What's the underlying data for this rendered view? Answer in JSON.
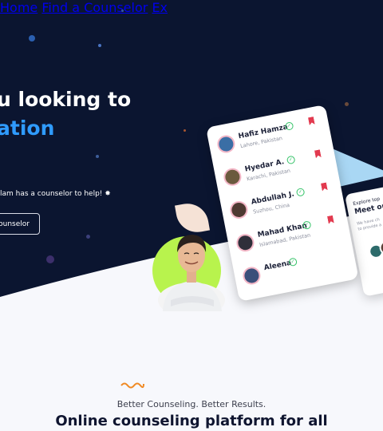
{
  "nav": {
    "items": [
      "Home",
      "Find a Counselor",
      "Ex"
    ]
  },
  "hero": {
    "headline_line1": "u looking to",
    "headline_line2": "ation",
    "subtext": "lam has a counselor to help! ✸",
    "cta_label": "Counselor"
  },
  "counselors": [
    {
      "name": "Hafiz Hamza",
      "location": "Lahore, Pakistan"
    },
    {
      "name": "Hyedar A.",
      "location": "Karachi, Pakistan"
    },
    {
      "name": "Abdullah J.",
      "location": "Suzhou, China"
    },
    {
      "name": "Mahad Khan",
      "location": "Islamabad, Pakistan"
    },
    {
      "name": "Aleena",
      "location": ""
    }
  ],
  "explore_card": {
    "small": "Explore top",
    "title": "Meet our",
    "body1": "We have ch",
    "body2": "to provide a"
  },
  "section": {
    "tagline": "Better Counseling. Better Results.",
    "title": "Online counseling platform for all"
  },
  "colors": {
    "hero_bg": "#0b1530",
    "accent_blue": "#2f9bff",
    "bookmark_red": "#e23a4f",
    "verified_green": "#39c46b",
    "lime": "#b8f34d",
    "squiggle_orange": "#f08a24"
  }
}
